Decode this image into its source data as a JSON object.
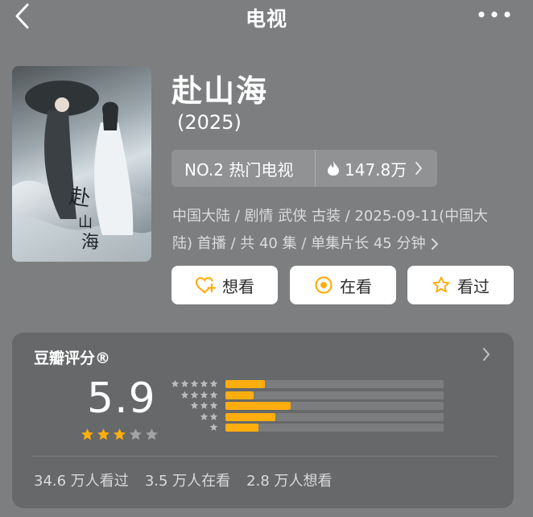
{
  "header": {
    "title": "电视",
    "back_icon": "chevron-left-icon",
    "more_icon": "more-dots-icon"
  },
  "show": {
    "title": "赴山海",
    "year": "(2025)",
    "rank_label": "NO.2 热门电视",
    "heat": "147.8万",
    "meta_line1": "中国大陆 / 剧情 武侠 古装 / 2025-09-11(中国大",
    "meta_line2": "陆) 首播 / 共 40 集 / 单集片长 45 分钟"
  },
  "actions": {
    "want": "想看",
    "watching": "在看",
    "watched": "看过"
  },
  "rating": {
    "title": "豆瓣评分®",
    "score": "5.9",
    "stars": 3,
    "max_stars": 5,
    "distribution": [
      {
        "stars": 5,
        "fraction": 0.18
      },
      {
        "stars": 4,
        "fraction": 0.13
      },
      {
        "stars": 3,
        "fraction": 0.3
      },
      {
        "stars": 2,
        "fraction": 0.23
      },
      {
        "stars": 1,
        "fraction": 0.15
      }
    ]
  },
  "stats": {
    "watched": "34.6 万人看过",
    "watching": "3.5 万人在看",
    "want": "2.8 万人想看"
  },
  "colors": {
    "accent": "#ffad0f",
    "background": "#7c7e7f",
    "card": "#666869"
  }
}
